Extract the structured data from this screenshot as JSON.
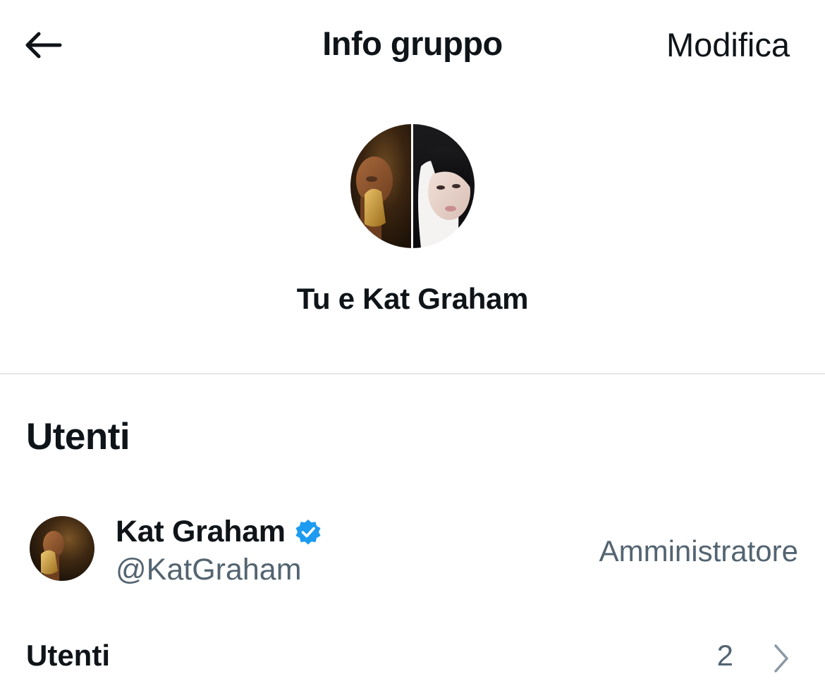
{
  "header": {
    "title": "Info gruppo",
    "edit_label": "Modifica",
    "back_icon": "arrow-left-icon"
  },
  "group": {
    "name": "Tu e Kat Graham",
    "avatar": "group-avatar-composite"
  },
  "members_section": {
    "title": "Utenti",
    "members": [
      {
        "name": "Kat Graham",
        "handle": "@KatGraham",
        "role": "Amministratore",
        "verified": true,
        "verified_icon": "verified-badge-icon"
      }
    ]
  },
  "users_row": {
    "label": "Utenti",
    "count": "2",
    "chevron_icon": "chevron-right-icon"
  },
  "colors": {
    "text_primary": "#0f1419",
    "text_secondary": "#536471",
    "divider": "#e4e6e8",
    "verified_blue": "#1d9bf0"
  }
}
